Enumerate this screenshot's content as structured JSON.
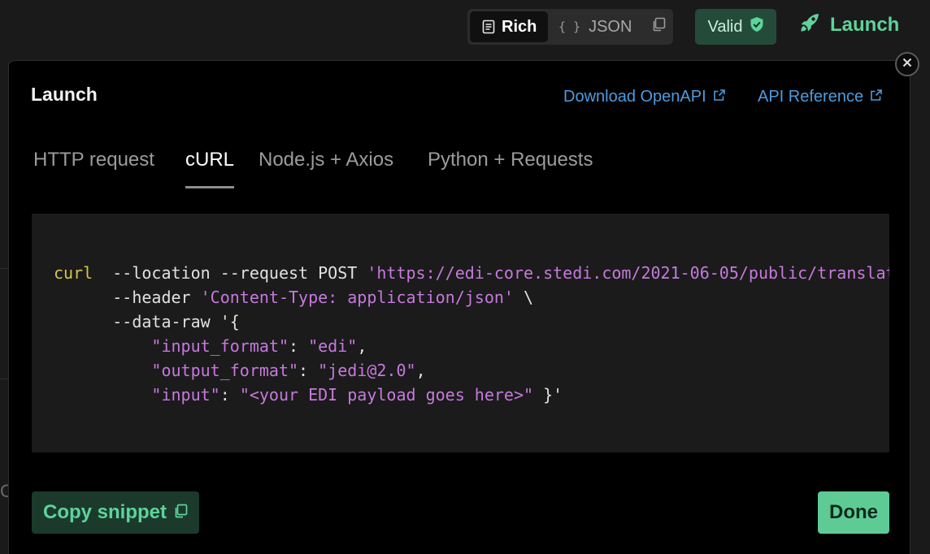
{
  "toolbar": {
    "view_modes": [
      {
        "label": "Rich",
        "icon": "document-icon",
        "active": true
      },
      {
        "label": "JSON",
        "icon": "braces-icon",
        "active": false
      }
    ],
    "braces_glyph": "{ }",
    "copy_icon": "copy-icon",
    "valid_label": "Valid",
    "valid_icon": "shield-check-icon",
    "launch_label": "Launch",
    "launch_icon": "rocket-icon"
  },
  "modal": {
    "title": "Launch",
    "links": [
      {
        "label": "Download OpenAPI",
        "icon": "external-link-icon"
      },
      {
        "label": "API Reference",
        "icon": "external-link-icon"
      }
    ],
    "close_icon": "close-icon",
    "tabs": [
      {
        "label": "HTTP request",
        "active": false
      },
      {
        "label": "cURL",
        "active": true
      },
      {
        "label": "Node.js + Axios",
        "active": false
      },
      {
        "label": "Python + Requests",
        "active": false
      }
    ],
    "code_lines": [
      [
        {
          "text": "curl",
          "kind": "cmd"
        },
        {
          "text": "  --location --request POST ",
          "kind": "txt"
        },
        {
          "text": "'https://edi-core.stedi.com/2021-06-05/public/translat",
          "kind": "str"
        }
      ],
      [
        {
          "text": "      --header ",
          "kind": "txt"
        },
        {
          "text": "'Content-Type: application/json'",
          "kind": "str"
        },
        {
          "text": " \\",
          "kind": "txt"
        }
      ],
      [
        {
          "text": "      --data-raw '{",
          "kind": "txt"
        }
      ],
      [
        {
          "text": "          ",
          "kind": "txt"
        },
        {
          "text": "\"input_format\"",
          "kind": "str"
        },
        {
          "text": ": ",
          "kind": "txt"
        },
        {
          "text": "\"edi\"",
          "kind": "str"
        },
        {
          "text": ",",
          "kind": "txt"
        }
      ],
      [
        {
          "text": "          ",
          "kind": "txt"
        },
        {
          "text": "\"output_format\"",
          "kind": "str"
        },
        {
          "text": ": ",
          "kind": "txt"
        },
        {
          "text": "\"jedi@2.0\"",
          "kind": "str"
        },
        {
          "text": ",",
          "kind": "txt"
        }
      ],
      [
        {
          "text": "          ",
          "kind": "txt"
        },
        {
          "text": "\"input\"",
          "kind": "str"
        },
        {
          "text": ": ",
          "kind": "txt"
        },
        {
          "text": "\"<your EDI payload goes here>\"",
          "kind": "str"
        },
        {
          "text": " }'",
          "kind": "txt"
        }
      ]
    ],
    "copy_snippet_label": "Copy snippet",
    "done_label": "Done"
  },
  "colors": {
    "accent_green": "#5ed39b",
    "link_blue": "#4d9bde",
    "code_string": "#c679dd",
    "code_command": "#d4c64a"
  }
}
